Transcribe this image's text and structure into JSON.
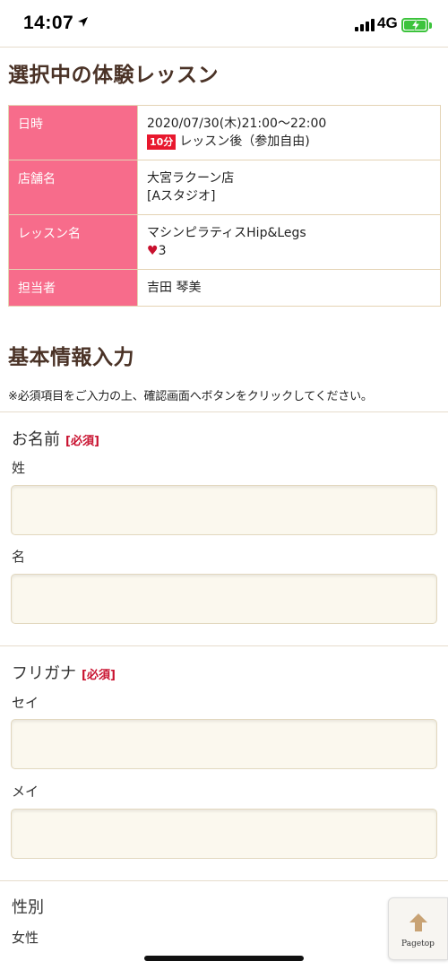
{
  "status_bar": {
    "time": "14:07",
    "network": "4G"
  },
  "selected_lesson": {
    "title": "選択中の体験レッスン",
    "rows": [
      {
        "label": "日時",
        "value": "2020/07/30(木)21:00〜22:00",
        "tag": "10分",
        "extra": "レッスン後（参加自由)"
      },
      {
        "label": "店舗名",
        "value": "大宮ラクーン店",
        "extra": "[Aスタジオ]"
      },
      {
        "label": "レッスン名",
        "value": "マシンピラティスHip&Legs",
        "heart": "♥",
        "extra": "3"
      },
      {
        "label": "担当者",
        "value": "吉田 琴美"
      }
    ]
  },
  "basic_info": {
    "title": "基本情報入力",
    "note": "※必須項目をご入力の上、確認画面へボタンをクリックしてください。",
    "name_group": {
      "label": "お名前",
      "required": "[必須]",
      "last_label": "姓",
      "last_value": "",
      "first_label": "名",
      "first_value": ""
    },
    "kana_group": {
      "label": "フリガナ",
      "required": "[必須]",
      "last_label": "セイ",
      "last_value": "",
      "first_label": "メイ",
      "first_value": ""
    },
    "gender_group": {
      "label": "性別",
      "value": "女性"
    }
  },
  "pagetop": {
    "label": "Pagetop"
  },
  "colors": {
    "header_cell": "#f76c8b",
    "title_brown": "#4a3226",
    "required_red": "#c8102e",
    "input_bg": "#fbf8ee",
    "battery_green": "#3cc33c"
  },
  "icons": [
    "location-arrow-icon",
    "signal-icon",
    "battery-charging-icon",
    "arrow-up-icon"
  ]
}
